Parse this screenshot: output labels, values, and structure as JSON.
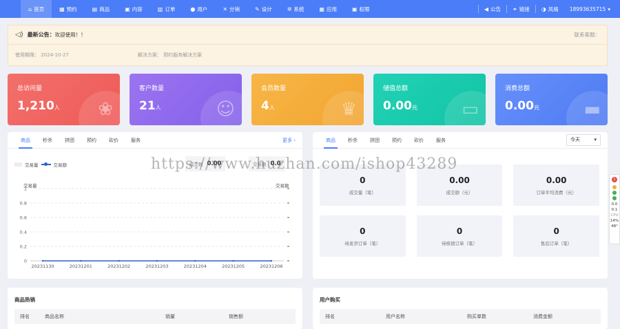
{
  "nav": {
    "items": [
      {
        "label": "首页",
        "icon": "home-icon",
        "glyph": "⌂",
        "active": true
      },
      {
        "label": "预约",
        "icon": "calendar-icon",
        "glyph": "▦"
      },
      {
        "label": "商品",
        "icon": "shop-icon",
        "glyph": "▤"
      },
      {
        "label": "内容",
        "icon": "content-icon",
        "glyph": "▣"
      },
      {
        "label": "订单",
        "icon": "order-icon",
        "glyph": "▥"
      },
      {
        "label": "用户",
        "icon": "user-icon",
        "glyph": "●"
      },
      {
        "label": "分销",
        "icon": "share-icon",
        "glyph": "✕"
      },
      {
        "label": "设计",
        "icon": "design-icon",
        "glyph": "✎"
      },
      {
        "label": "系统",
        "icon": "gear-icon",
        "glyph": "✲"
      },
      {
        "label": "应用",
        "icon": "apps-icon",
        "glyph": "▦"
      },
      {
        "label": "权限",
        "icon": "lock-icon",
        "glyph": "▣"
      }
    ],
    "right": {
      "announce": "公告",
      "link": "链接",
      "style": "风格",
      "account": "18993635715"
    }
  },
  "notice": {
    "title": "最新公告：",
    "message": "欢迎使用！！",
    "contact": "联系客服：",
    "expire": "使用期限：  2024-10-27",
    "info": "解决方案：  预约服务解决方案"
  },
  "stats": [
    {
      "label": "总访问量",
      "value": "1,210",
      "unit": "人",
      "icon": "paw-icon",
      "glyph": "❀",
      "color1": "#f3706a",
      "color2": "#ee5a58"
    },
    {
      "label": "客户数量",
      "value": "21",
      "unit": "人",
      "icon": "user-search-icon",
      "glyph": "☺",
      "color1": "#9c74f0",
      "color2": "#8460ea"
    },
    {
      "label": "会员数量",
      "value": "4",
      "unit": "人",
      "icon": "crown-icon",
      "glyph": "♛",
      "color1": "#f7b646",
      "color2": "#f2a531"
    },
    {
      "label": "储值总额",
      "value": "0.00",
      "unit": "元",
      "icon": "card-icon",
      "glyph": "▭",
      "color1": "#22d2b4",
      "color2": "#12c3a5"
    },
    {
      "label": "消费总额",
      "value": "0.00",
      "unit": "元",
      "icon": "wallet-icon",
      "glyph": "▬",
      "color1": "#6690fa",
      "color2": "#4f7bf3"
    }
  ],
  "left_panel": {
    "tabs": [
      "商品",
      "秒杀",
      "拼团",
      "预约",
      "砍价",
      "服务"
    ],
    "more": "更多 ›",
    "legend_bar": "交易量",
    "legend_line": "交易额",
    "kpi1_label": "成交数",
    "kpi1_value": "0.00",
    "kpi2_label": "交易额",
    "kpi2_value": "0.0"
  },
  "right_panel": {
    "tabs": [
      "商品",
      "秒杀",
      "拼团",
      "预约",
      "砍价",
      "服务"
    ],
    "select": "今天",
    "boxes": [
      {
        "value": "0",
        "label": "成交量（笔）"
      },
      {
        "value": "0.00",
        "label": "成交额（元）"
      },
      {
        "value": "0.00",
        "label": "订单平均消费（元）"
      },
      {
        "value": "0",
        "label": "待发货订单（笔）"
      },
      {
        "value": "0",
        "label": "待核销订单（笔）"
      },
      {
        "value": "0",
        "label": "售后订单（笔）"
      }
    ]
  },
  "hot_goods": {
    "title": "商品热销",
    "columns": [
      "排名",
      "商品名称",
      "销量",
      "销售额"
    ]
  },
  "user_purchase": {
    "title": "用户购买",
    "columns": [
      "排名",
      "用户名称",
      "购买单数",
      "消费金额"
    ]
  },
  "chart_data": {
    "type": "line",
    "x": [
      "20231130",
      "20231201",
      "20231202",
      "20231203",
      "20231204",
      "20231205",
      "20231206"
    ],
    "series": [
      {
        "name": "交易量",
        "values": [
          0,
          0,
          0,
          0,
          0,
          0,
          0
        ]
      },
      {
        "name": "交易额",
        "values": [
          0,
          0,
          0,
          0,
          0,
          0,
          0
        ]
      }
    ],
    "ylabel_left": "交易量",
    "ylabel_right": "交易额",
    "yticks": [
      0,
      0.2,
      0.4,
      0.6,
      0.8,
      1
    ],
    "ylim": [
      0,
      1
    ],
    "line_color": "#2f5fd1"
  },
  "side_widget": {
    "badge": "1",
    "v1": "0.0",
    "v2": "0.1",
    "cpu": "CPU",
    "p1": "14%",
    "p2": "48°"
  },
  "watermark": "https://www.huzhan.com/ishop43289"
}
